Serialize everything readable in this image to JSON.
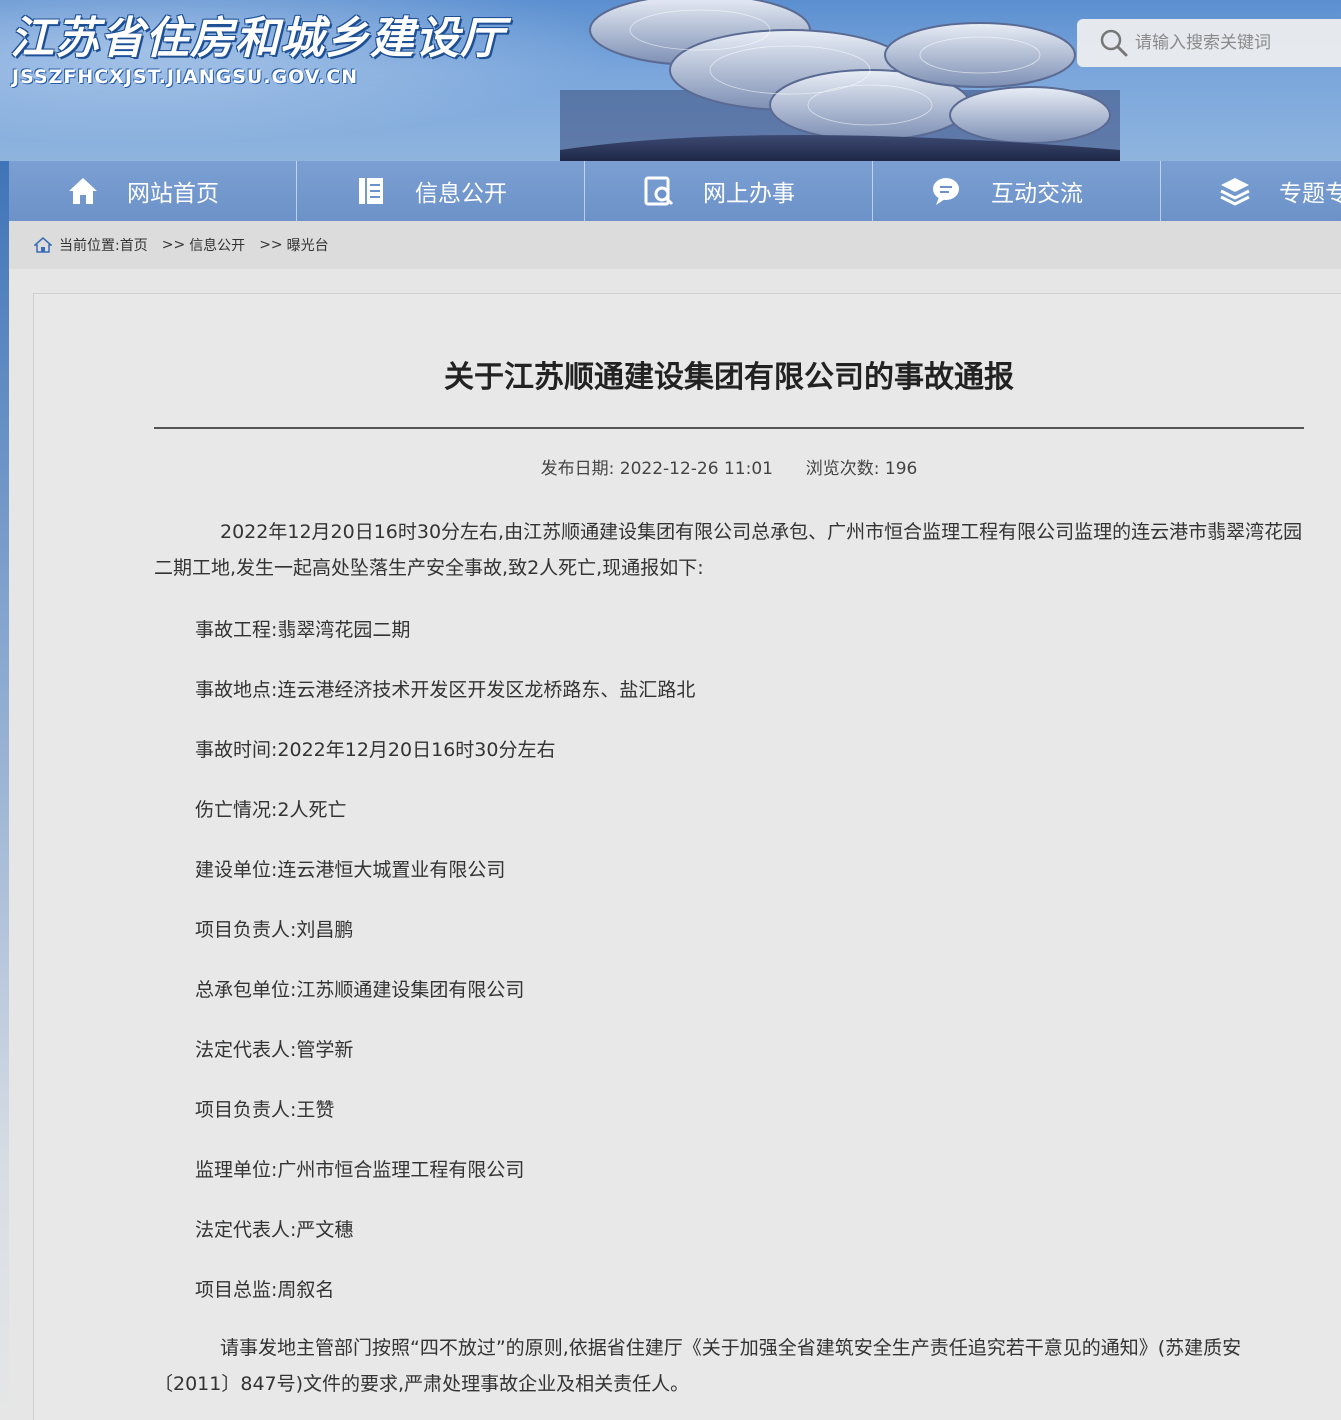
{
  "header": {
    "site_title": "江苏省住房和城乡建设厅",
    "site_domain": "JSSZFHCXJST.JIANGSU.GOV.CN",
    "search_placeholder": "请输入搜索关键词"
  },
  "nav": {
    "items": [
      {
        "label": "网站首页",
        "icon": "home-icon"
      },
      {
        "label": "信息公开",
        "icon": "document-icon"
      },
      {
        "label": "网上办事",
        "icon": "service-icon"
      },
      {
        "label": "互动交流",
        "icon": "chat-icon"
      },
      {
        "label": "专题专栏",
        "icon": "layers-icon"
      }
    ]
  },
  "breadcrumb": {
    "prefix": "当前位置:",
    "home": "首页",
    "sep1": ">>",
    "level1": "信息公开",
    "sep2": ">>",
    "level2": "曝光台"
  },
  "article": {
    "title": "关于江苏顺通建设集团有限公司的事故通报",
    "publish_label": "发布日期:",
    "publish_date": "2022-12-26 11:01",
    "views_label": "浏览次数:",
    "views": "196",
    "intro": "2022年12月20日16时30分左右,由江苏顺通建设集团有限公司总承包、广州市恒合监理工程有限公司监理的连云港市翡翠湾花园二期工地,发生一起高处坠落生产安全事故,致2人死亡,现通报如下:",
    "fields": [
      "事故工程:翡翠湾花园二期",
      "事故地点:连云港经济技术开发区开发区龙桥路东、盐汇路北",
      "事故时间:2022年12月20日16时30分左右",
      "伤亡情况:2人死亡",
      "建设单位:连云港恒大城置业有限公司",
      "项目负责人:刘昌鹏",
      "总承包单位:江苏顺通建设集团有限公司",
      "法定代表人:管学新",
      "项目负责人:王赞",
      "监理单位:广州市恒合监理工程有限公司",
      "法定代表人:严文穗",
      "项目总监:周叙名"
    ],
    "closing": "请事发地主管部门按照“四不放过”的原则,依据省住建厅《关于加强全省建筑安全生产责任追究若干意见的通知》(苏建质安〔2011〕847号)文件的要求,严肃处理事故企业及相关责任人。"
  },
  "colors": {
    "nav_bg": "#7199cd",
    "banner_sky": "#6e9ed8",
    "title_outline": "#1d4f95",
    "page_bg": "#e6e6e6"
  }
}
